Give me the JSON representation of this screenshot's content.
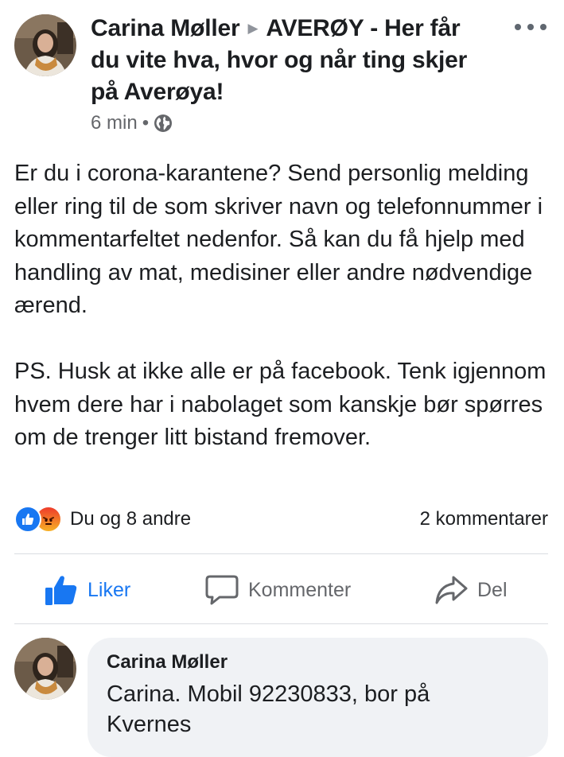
{
  "post": {
    "author": "Carina Møller",
    "group": "AVERØY - Her får du vite hva, hvor og når ting skjer på Averøya!",
    "time": "6 min",
    "separator": "•",
    "privacy_icon": "globe-icon",
    "body": [
      "Er du i corona-karantene? Send personlig melding eller ring til de som skriver navn og telefonnummer i kommentarfeltet nedenfor. Så kan du få hjelp med handling av mat, medisiner eller andre nødvendige ærend.",
      "PS. Husk at ikke alle er på facebook. Tenk igjennom hvem dere har i nabolaget som kanskje bør spørres om de trenger litt bistand fremover."
    ]
  },
  "reactions": {
    "icons": [
      "like-icon",
      "angry-icon"
    ],
    "text": "Du og 8 andre",
    "comments": "2 kommentarer"
  },
  "actions": {
    "like": "Liker",
    "comment": "Kommenter",
    "share": "Del"
  },
  "comment": {
    "author": "Carina Møller",
    "text": "Carina. Mobil 92230833, bor på Kvernes"
  },
  "colors": {
    "accent": "#1877f2",
    "text": "#1c1e21",
    "secondary": "#65676b",
    "bubble": "#f0f2f5",
    "divider": "#dadde1"
  }
}
